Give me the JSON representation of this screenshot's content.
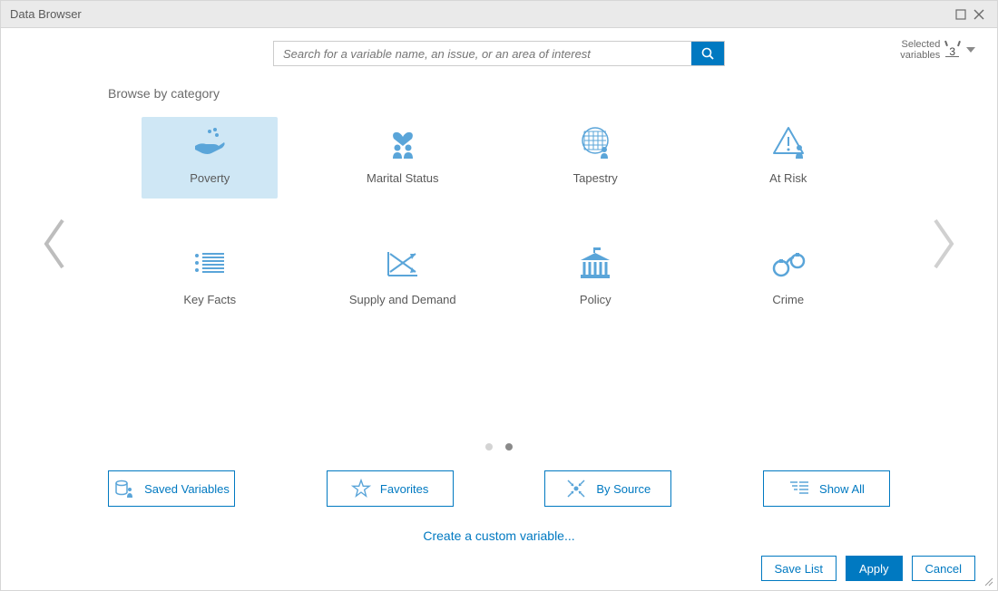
{
  "window": {
    "title": "Data Browser"
  },
  "search": {
    "placeholder": "Search for a variable name, an issue, or an area of interest"
  },
  "selected": {
    "label_line1": "Selected",
    "label_line2": "variables",
    "count": "3"
  },
  "browse_label": "Browse by category",
  "categories": [
    {
      "label": "Poverty",
      "icon": "hand-coins",
      "selected": true
    },
    {
      "label": "Marital Status",
      "icon": "heart-people",
      "selected": false
    },
    {
      "label": "Tapestry",
      "icon": "grid-person",
      "selected": false
    },
    {
      "label": "At Risk",
      "icon": "warning-person",
      "selected": false
    },
    {
      "label": "Key Facts",
      "icon": "list",
      "selected": false
    },
    {
      "label": "Supply and Demand",
      "icon": "supply-demand",
      "selected": false
    },
    {
      "label": "Policy",
      "icon": "gov",
      "selected": false
    },
    {
      "label": "Crime",
      "icon": "handcuffs",
      "selected": false
    }
  ],
  "pagination": {
    "dots": 2,
    "active": 1
  },
  "secondary": [
    {
      "label": "Saved Variables",
      "icon": "db-person"
    },
    {
      "label": "Favorites",
      "icon": "star"
    },
    {
      "label": "By Source",
      "icon": "converge"
    },
    {
      "label": "Show All",
      "icon": "show-all"
    }
  ],
  "custom_link": "Create a custom variable...",
  "buttons": {
    "save": "Save List",
    "apply": "Apply",
    "cancel": "Cancel"
  }
}
